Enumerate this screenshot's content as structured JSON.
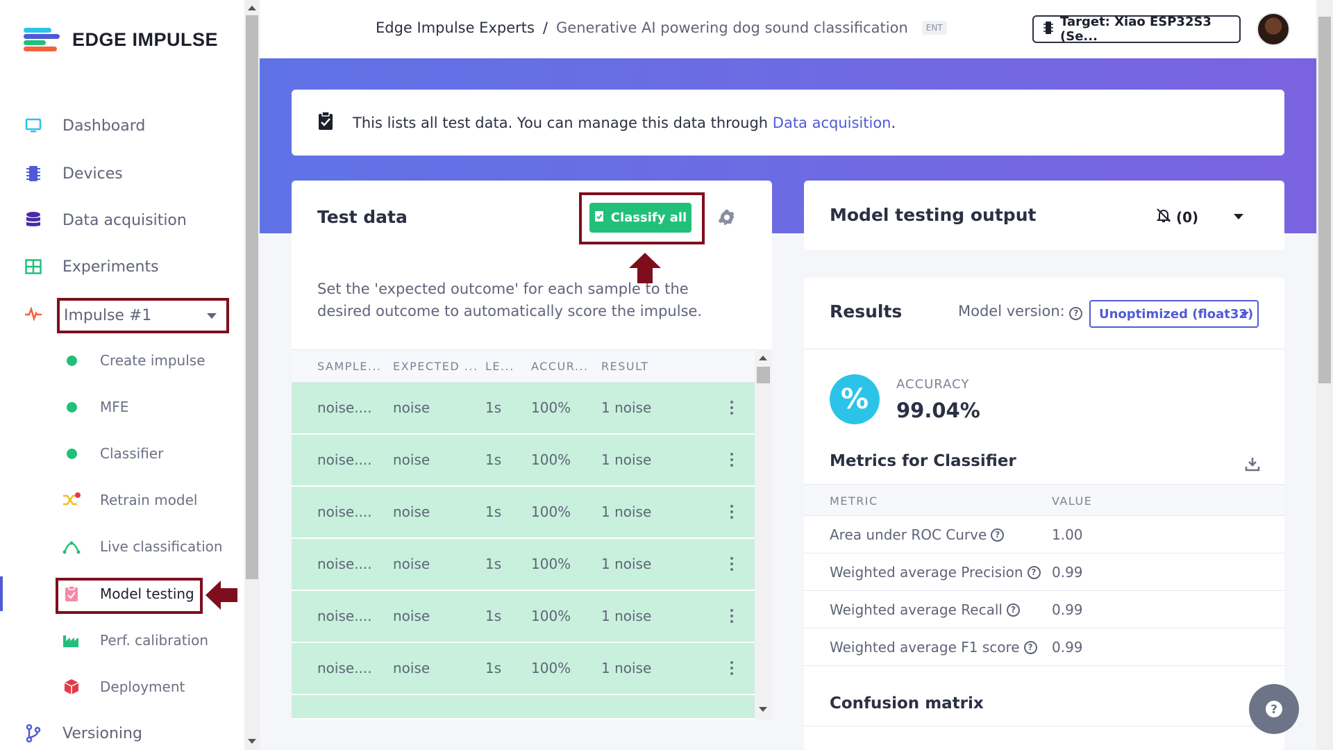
{
  "brand": {
    "name": "EDGE IMPULSE"
  },
  "sidebar": {
    "items": [
      {
        "label": "Dashboard",
        "icon": "monitor-icon"
      },
      {
        "label": "Devices",
        "icon": "chip-icon"
      },
      {
        "label": "Data acquisition",
        "icon": "database-icon"
      },
      {
        "label": "Experiments",
        "icon": "grid-icon"
      }
    ],
    "impulse": {
      "label": "Impulse #1",
      "icon": "pulse-icon"
    },
    "sub_items": [
      {
        "label": "Create impulse",
        "icon": "dot-icon"
      },
      {
        "label": "MFE",
        "icon": "dot-icon"
      },
      {
        "label": "Classifier",
        "icon": "dot-icon"
      },
      {
        "label": "Retrain model",
        "icon": "shuffle-icon"
      },
      {
        "label": "Live classification",
        "icon": "live-icon"
      },
      {
        "label": "Model testing",
        "icon": "clipboard-icon"
      },
      {
        "label": "Perf. calibration",
        "icon": "factory-icon"
      },
      {
        "label": "Deployment",
        "icon": "box-icon"
      }
    ],
    "versioning": {
      "label": "Versioning",
      "icon": "branch-icon"
    }
  },
  "header": {
    "org": "Edge Impulse Experts",
    "separator": "/",
    "project": "Generative AI powering dog sound classification",
    "badge": "ENT",
    "target": "Target: Xiao ESP32S3 (Se..."
  },
  "info": {
    "text": "This lists all test data. You can manage this data through ",
    "link": "Data acquisition",
    "suffix": "."
  },
  "test_data": {
    "title": "Test data",
    "classify_label": "Classify all",
    "hint": "Set the 'expected outcome' for each sample to the desired outcome to automatically score the impulse.",
    "columns": [
      "SAMPLE...",
      "EXPECTED ...",
      "LE...",
      "ACCUR...",
      "RESULT"
    ],
    "rows": [
      [
        "noise....",
        "noise",
        "1s",
        "100%",
        "1 noise"
      ],
      [
        "noise....",
        "noise",
        "1s",
        "100%",
        "1 noise"
      ],
      [
        "noise....",
        "noise",
        "1s",
        "100%",
        "1 noise"
      ],
      [
        "noise....",
        "noise",
        "1s",
        "100%",
        "1 noise"
      ],
      [
        "noise....",
        "noise",
        "1s",
        "100%",
        "1 noise"
      ],
      [
        "noise....",
        "noise",
        "1s",
        "100%",
        "1 noise"
      ]
    ]
  },
  "output": {
    "title": "Model testing output",
    "notifications": "(0)"
  },
  "results": {
    "title": "Results",
    "model_version_label": "Model version:",
    "model_version_value": "Unoptimized (float32)",
    "accuracy_label": "ACCURACY",
    "accuracy_value": "99.04%",
    "metrics_title": "Metrics for Classifier",
    "metric_col": "METRIC",
    "value_col": "VALUE",
    "metrics": [
      {
        "name": "Area under ROC Curve",
        "value": "1.00"
      },
      {
        "name": "Weighted average Precision",
        "value": "0.99"
      },
      {
        "name": "Weighted average Recall",
        "value": "0.99"
      },
      {
        "name": "Weighted average F1 score",
        "value": "0.99"
      }
    ],
    "confusion_title": "Confusion matrix"
  },
  "colors": {
    "accent": "#4f5bd5",
    "success": "#21c07a",
    "row_bg": "#c8f0dc",
    "highlight": "#7f0e1c"
  }
}
